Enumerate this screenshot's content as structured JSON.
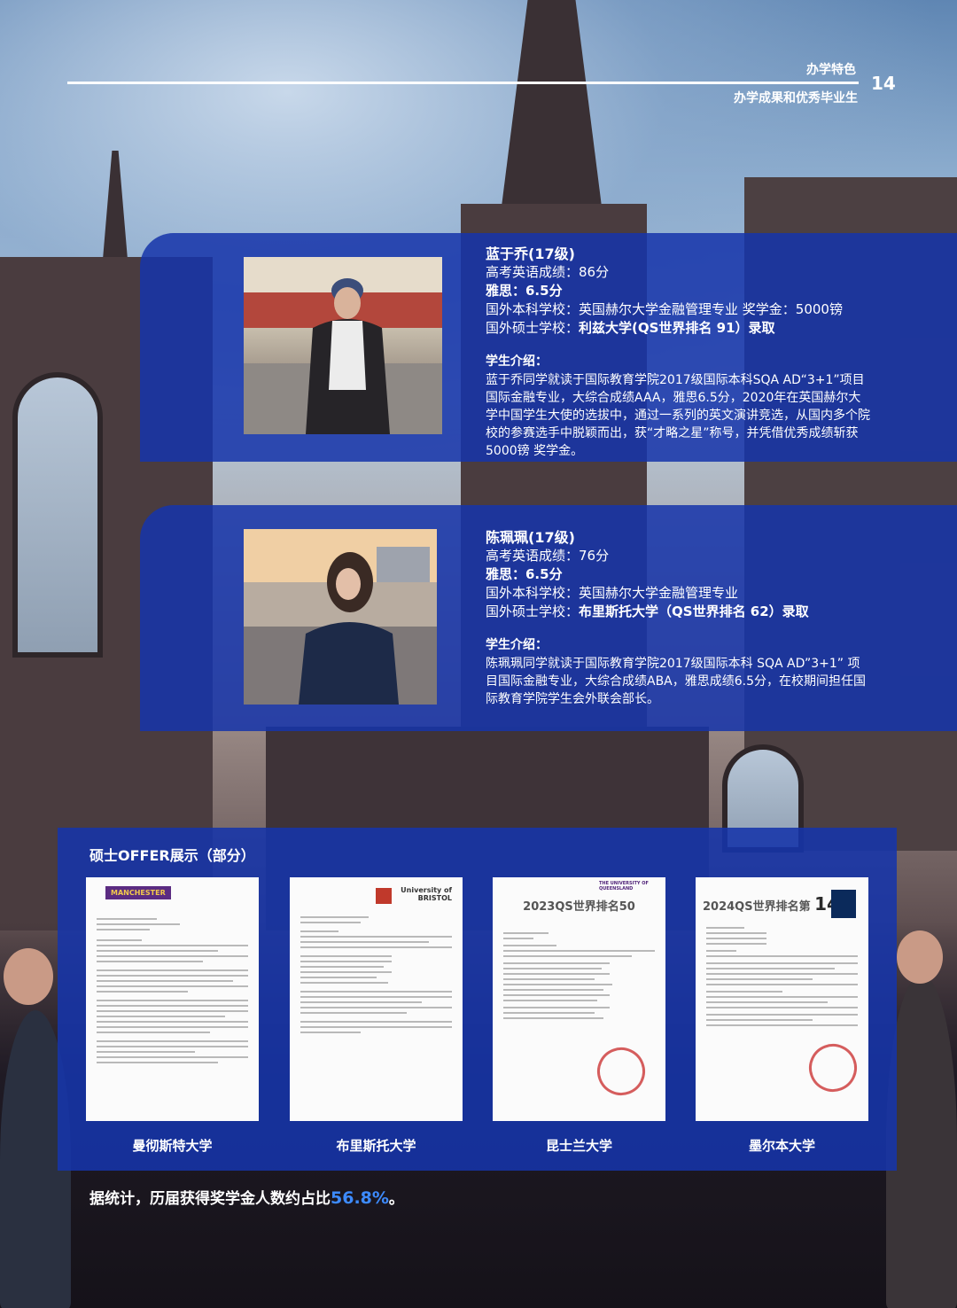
{
  "header": {
    "category": "办学特色",
    "subtitle": "办学成果和优秀毕业生",
    "page_number": "14"
  },
  "students": [
    {
      "name": "蓝于乔(17级)",
      "gaokao_english": "高考英语成绩：86分",
      "ielts": "雅思：6.5分",
      "undergrad_label": "国外本科学校：",
      "undergrad_value": "英国赫尔大学金融管理专业  奖学金：5000镑",
      "master_label": "国外硕士学校：",
      "master_value": "利兹大学(QS世界排名 91）录取",
      "intro_title": "学生介绍：",
      "intro": "蓝于乔同学就读于国际教育学院2017级国际本科SQA    AD“3+1”项目国际金融专业，大综合成绩AAA，雅思6.5分，2020年在英国赫尔大学中国学生大使的选拔中，通过一系列的英文演讲竞选，从国内多个院校的参赛选手中脱颖而出，获“才略之星”称号，并凭借优秀成绩斩获5000镑 奖学金。"
    },
    {
      "name": "陈珮珮(17级)",
      "gaokao_english": "高考英语成绩：76分",
      "ielts": "雅思：6.5分",
      "undergrad_label": "国外本科学校：",
      "undergrad_value": "英国赫尔大学金融管理专业",
      "master_label": "国外硕士学校：",
      "master_value": "布里斯托大学（QS世界排名 62）录取",
      "intro_title": "学生介绍：",
      "intro": "陈珮珮同学就读于国际教育学院2017级国际本科 SQA AD”3+1”  项目国际金融专业，大综合成绩ABA，雅思成绩6.5分，在校期间担任国际教育学院学生会外联会部长。"
    }
  ],
  "offers": {
    "title": "硕士OFFER展示（部分）",
    "documents": [
      {
        "university": "曼彻斯特大学",
        "logo_text": "MANCHESTER",
        "rank_caption": ""
      },
      {
        "university": "布里斯托大学",
        "logo_text": "University of BRISTOL",
        "rank_caption": ""
      },
      {
        "university": "昆士兰大学",
        "logo_text": "THE UNIVERSITY OF QUEENSLAND",
        "rank_caption": "2023QS世界排名50"
      },
      {
        "university": "墨尔本大学",
        "logo_text": "",
        "rank_caption": "2024QS世界排名第",
        "rank_number": "14"
      }
    ]
  },
  "statistic": {
    "text": "据统计，历届获得奖学金人数约占比",
    "percent": "56.8%",
    "end": "。"
  },
  "colors": {
    "panel_blue": "#1634aa",
    "highlight_blue": "#3d8bff",
    "text": "#ffffff"
  }
}
